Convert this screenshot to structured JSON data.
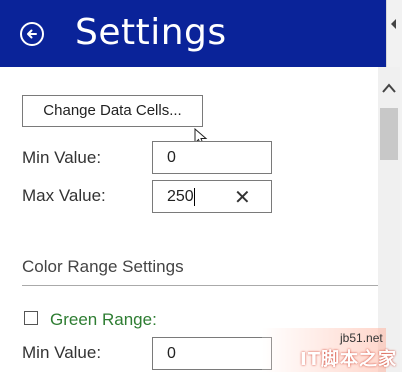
{
  "header": {
    "title": "Settings"
  },
  "data_section": {
    "change_button_label": "Change Data Cells..."
  },
  "range": {
    "min_label": "Min Value:",
    "min_value": "0",
    "max_label": "Max Value:",
    "max_value": "250",
    "clear_glyph": "✕"
  },
  "color_range": {
    "section_title": "Color Range Settings",
    "green": {
      "label": "Green Range:",
      "checked": false,
      "min_label": "Min Value:",
      "min_value": "0"
    }
  },
  "watermark": {
    "site": "jb51.net",
    "text": "IT脚本之家"
  },
  "colors": {
    "header_bg": "#0a2399",
    "green_label": "#2e7d32"
  }
}
